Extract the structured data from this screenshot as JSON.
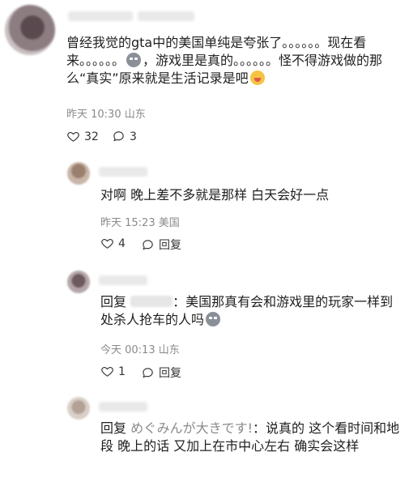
{
  "main_comment": {
    "text_part1": "曾经我觉的gta中的美国单纯是夸张了。。。。。。现在看来。。。。。。",
    "text_part2": "，游戏里是真的。。。。。。怪不得游戏做的那么“真实”原来就是生活记录是吧",
    "emoji_1": "sticker-icon",
    "emoji_2": "face-emoji-icon",
    "meta": "昨天 10:30 山东",
    "likes": "32",
    "replies": "3"
  },
  "replies": [
    {
      "text": "对啊 晚上差不多就是那样 白天会好一点",
      "meta": "昨天 15:23 美国",
      "likes": "4",
      "reply_label": "回复"
    },
    {
      "reply_prefix": "回复",
      "text": "：美国那真有会和游戏里的玩家一样到处杀人抢车的人吗",
      "emoji": "sticker-icon",
      "meta": "今天 00:13 山东",
      "likes": "1",
      "reply_label": "回复"
    },
    {
      "reply_prefix": "回复",
      "target_name": "めぐみんが大きです!",
      "text": "：说真的 这个看时间和地段 晚上的话 又加上在市中心左右 确实会这样"
    }
  ]
}
